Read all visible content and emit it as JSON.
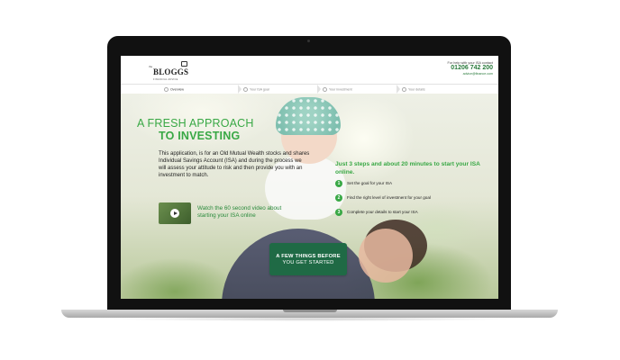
{
  "header": {
    "logo_word": "BLOGGS",
    "logo_prefix": "the",
    "logo_tagline": "FINANCIAL ADVICE",
    "contact_label": "For help with your ISA contact",
    "contact_phone": "01206 742 200",
    "contact_email": "advice@finance.com"
  },
  "steps_bar": {
    "items": [
      {
        "label": "Overview"
      },
      {
        "label": "Your ISA goal"
      },
      {
        "label": "Your investment"
      },
      {
        "label": "Your details"
      }
    ]
  },
  "hero": {
    "headline_line1": "A FRESH APPROACH",
    "headline_line2": "TO INVESTING",
    "intro": "This application, is for an Old Mutual Wealth stocks and shares Individual Savings Account (ISA) and during the process we will assess your attitude to risk and then provide you with an investment to match.",
    "video_text": "Watch the 60 second video about starting your ISA online"
  },
  "steps_panel": {
    "title": "Just 3 steps and about 20 minutes to start your ISA online.",
    "items": [
      {
        "num": "1",
        "text": "Set the goal for your ISA"
      },
      {
        "num": "2",
        "text": "Find the right level of investment for your goal"
      },
      {
        "num": "3",
        "text": "Complete your details to start your ISA"
      }
    ]
  },
  "cta": {
    "line1": "A FEW THINGS BEFORE",
    "line2": "YOU GET STARTED"
  },
  "colors": {
    "brand_green": "#39a845",
    "cta_green": "#1f6a45"
  }
}
